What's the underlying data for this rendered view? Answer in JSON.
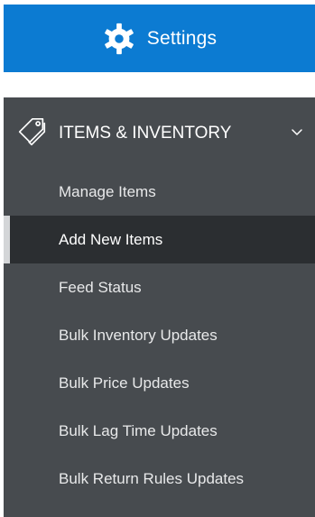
{
  "settings": {
    "label": "Settings",
    "icon": "gear-icon",
    "color": "#0c7bd2"
  },
  "sidebar": {
    "section": {
      "title": "ITEMS & INVENTORY",
      "icon": "tag-icon",
      "expand_icon": "chevron-down-icon",
      "expanded": true
    },
    "items": [
      {
        "label": "Manage Items",
        "active": false
      },
      {
        "label": "Add New Items",
        "active": true
      },
      {
        "label": "Feed Status",
        "active": false
      },
      {
        "label": "Bulk Inventory Updates",
        "active": false
      },
      {
        "label": "Bulk Price Updates",
        "active": false
      },
      {
        "label": "Bulk Lag Time Updates",
        "active": false
      },
      {
        "label": "Bulk Return Rules Updates",
        "active": false
      }
    ],
    "colors": {
      "background": "#474b4f",
      "active_background": "#2b2e31",
      "active_indicator": "#d4d6d8"
    }
  }
}
